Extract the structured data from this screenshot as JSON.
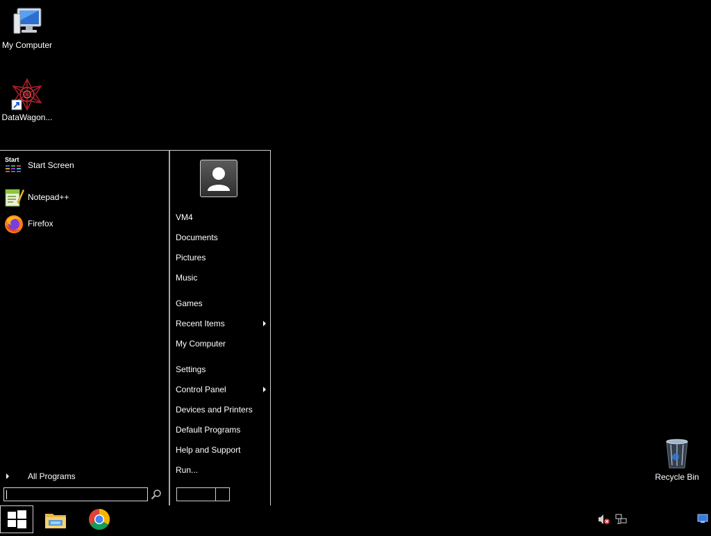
{
  "desktop": {
    "icons": [
      {
        "label": "My Computer",
        "icon": "computer-icon"
      },
      {
        "label": "DataWagon...",
        "icon": "datawagon-icon"
      },
      {
        "label": "Recycle Bin",
        "icon": "recycle-bin-icon"
      }
    ]
  },
  "start_menu": {
    "programs": [
      {
        "label": "Start Screen",
        "icon": "start-screen-icon",
        "icon_caption": "Start"
      },
      {
        "label": "Notepad++",
        "icon": "notepad-plus-plus-icon"
      },
      {
        "label": "Firefox",
        "icon": "firefox-icon"
      }
    ],
    "all_programs": "All Programs",
    "search": {
      "value": "",
      "placeholder": ""
    },
    "right": {
      "user": "VM4",
      "items": [
        {
          "label": "Documents"
        },
        {
          "label": "Pictures"
        },
        {
          "label": "Music"
        },
        {
          "label": "Games"
        },
        {
          "label": "Recent Items",
          "submenu": true
        },
        {
          "label": "My Computer"
        },
        {
          "label": "Settings"
        },
        {
          "label": "Control Panel",
          "submenu": true
        },
        {
          "label": "Devices and Printers"
        },
        {
          "label": "Default Programs"
        },
        {
          "label": "Help and Support"
        },
        {
          "label": "Run..."
        }
      ]
    }
  },
  "taskbar": {
    "start_icon": "windows-logo-icon",
    "pinned": [
      {
        "name": "File Explorer",
        "icon": "file-explorer-icon"
      },
      {
        "name": "Chrome",
        "icon": "chrome-icon"
      }
    ],
    "tray": [
      {
        "icon": "volume-muted-icon"
      },
      {
        "icon": "network-icon"
      },
      {
        "icon": "show-desktop-icon"
      }
    ]
  },
  "colors": {
    "background": "#000000",
    "border": "#cfcfcf",
    "text": "#ffffff"
  }
}
